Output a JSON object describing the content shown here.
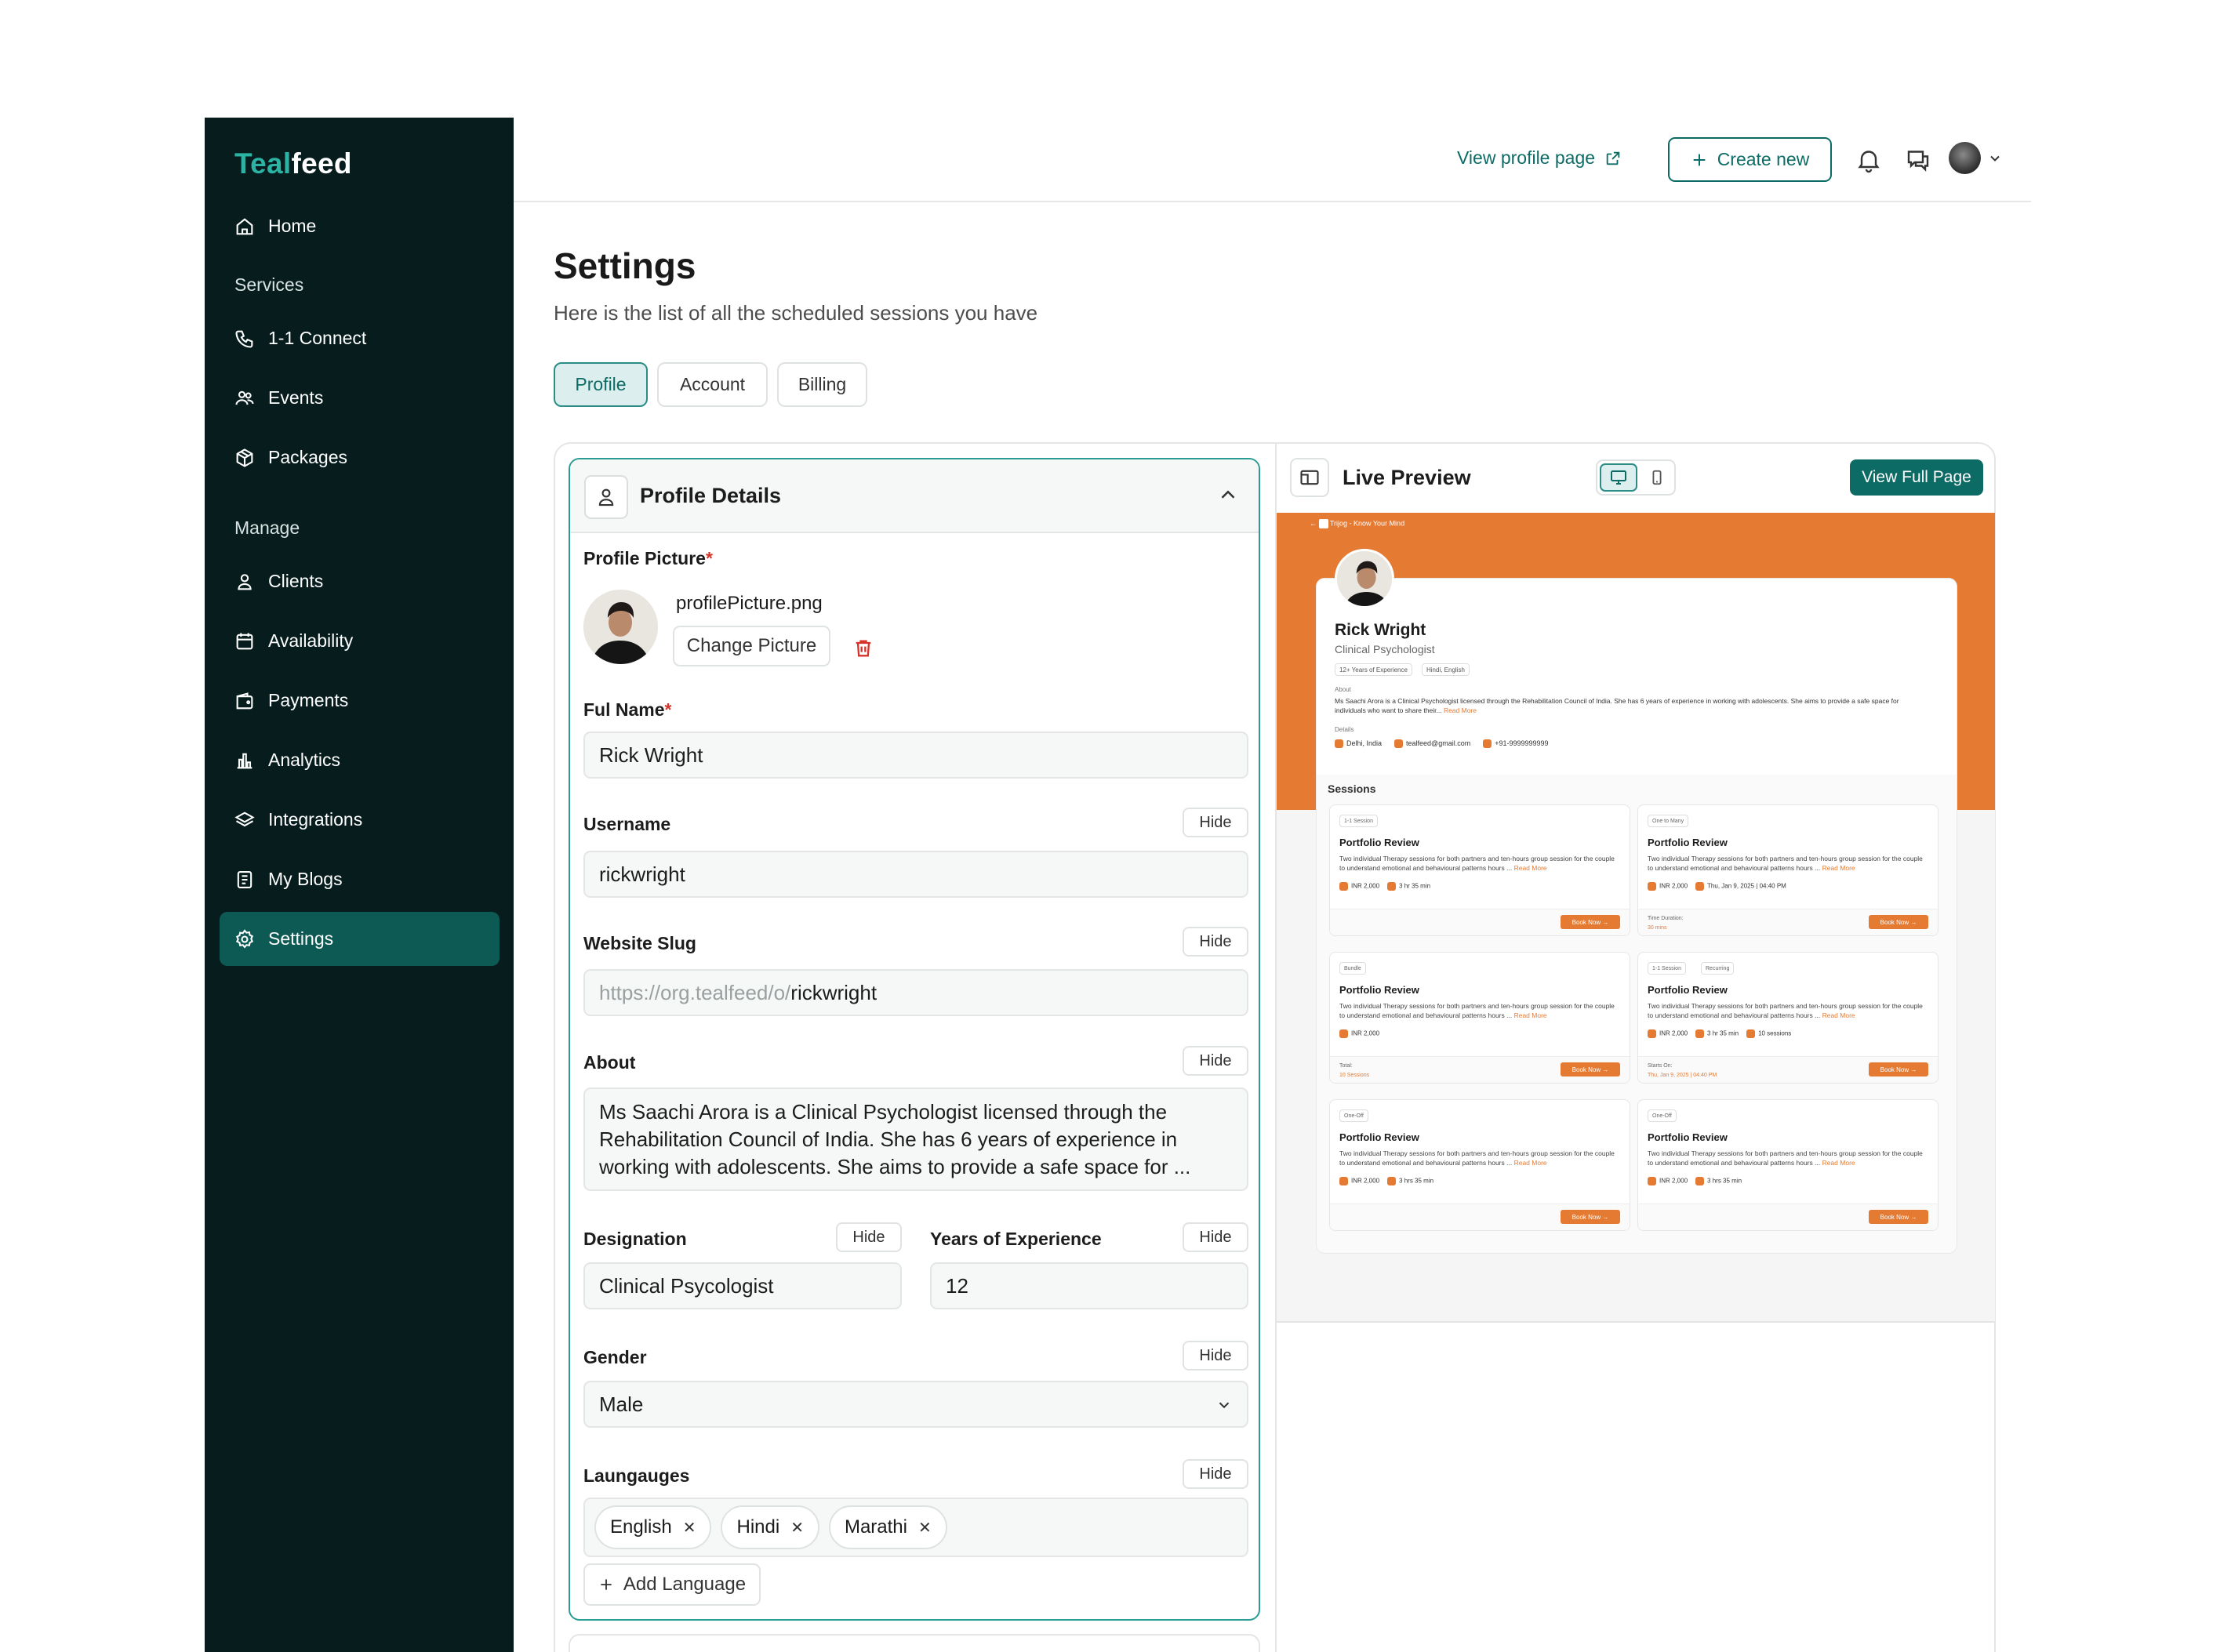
{
  "brand": {
    "part1": "Teal",
    "part2": "feed",
    "accent": "#2bb3a4",
    "sidebar_bg": "#061c1d",
    "primary": "#0d6b65",
    "preview_accent": "#e57a32"
  },
  "sidebar": {
    "home": "Home",
    "services_heading": "Services",
    "services": [
      "1-1 Connect",
      "Events",
      "Packages"
    ],
    "manage_heading": "Manage",
    "manage": [
      "Clients",
      "Availability",
      "Payments",
      "Analytics",
      "Integrations",
      "My Blogs",
      "Settings"
    ],
    "active": "Settings"
  },
  "header": {
    "view_profile": "View profile page",
    "create_new": "Create new",
    "icons": [
      "bell-icon",
      "chat-icon",
      "avatar",
      "chevron-down-icon"
    ]
  },
  "page": {
    "title": "Settings",
    "subtitle": "Here is the list of all the scheduled sessions you have",
    "tabs": [
      "Profile",
      "Account",
      "Billing"
    ],
    "active_tab": "Profile"
  },
  "profile": {
    "section_title": "Profile Details",
    "hide_label": "Hide",
    "picture": {
      "label": "Profile Picture",
      "req": "*",
      "filename": "profilePicture.png",
      "change": "Change Picture"
    },
    "fullname": {
      "label": "Ful Name",
      "req": "*",
      "value": "Rick Wright"
    },
    "username": {
      "label": "Username",
      "value": "rickwright"
    },
    "slug": {
      "label": "Website Slug",
      "prefix": "https://org.tealfeed/o/",
      "value": "rickwright"
    },
    "about": {
      "label": "About",
      "value": "Ms Saachi Arora is a Clinical Psychologist licensed through the Rehabilitation Council of India. She has 6 years of experience in working with adolescents. She aims to provide a safe space for ..."
    },
    "designation": {
      "label": "Designation",
      "value": "Clinical Psycologist"
    },
    "experience": {
      "label": "Years of Experience",
      "value": "12"
    },
    "gender": {
      "label": "Gender",
      "value": "Male"
    },
    "languages": {
      "label": "Laungauges",
      "items": [
        "English",
        "Hindi",
        "Marathi"
      ],
      "add": "Add Language"
    }
  },
  "preview": {
    "title": "Live Preview",
    "view_full": "View Full Page",
    "topbar": "Trijog - Know Your Mind",
    "name": "Rick Wright",
    "role": "Clinical Psychologist",
    "tags": [
      "12+ Years of Experience",
      "Hindi, English"
    ],
    "about_label": "About",
    "about": "Ms Saachi Arora is a Clinical Psychologist licensed through the Rehabilitation Council of India. She has 6 years of experience in working with adolescents. She aims to provide a safe space for individuals who want to share their...",
    "read_more": "Read More",
    "details_label": "Details",
    "details": [
      "Delhi, India",
      "tealfeed@gmail.com",
      "+91-9999999999"
    ],
    "sessions_label": "Sessions",
    "sessions": [
      {
        "tags": [
          "1-1 Session"
        ],
        "title": "Portfolio Review",
        "desc": "Two individual Therapy sessions for both partners and ten-hours group session for the couple to understand emotional and behavioural patterns hours ...",
        "meta": [
          "INR 2,000",
          "3 hr 35 min"
        ],
        "foot_label": "",
        "foot_value": "",
        "book": "Book Now →"
      },
      {
        "tags": [
          "One to Many"
        ],
        "title": "Portfolio Review",
        "desc": "Two individual Therapy sessions for both partners and ten-hours group session for the couple to understand emotional and behavioural patterns hours ...",
        "meta": [
          "INR 2,000",
          "Thu, Jan 9, 2025 | 04:40 PM"
        ],
        "foot_label": "Time Duration:",
        "foot_value": "30 mins",
        "book": "Book Now →"
      },
      {
        "tags": [
          "Bundle"
        ],
        "title": "Portfolio Review",
        "desc": "Two individual Therapy sessions for both partners and ten-hours group session for the couple to understand emotional and behavioural patterns hours ...",
        "meta": [
          "INR 2,000"
        ],
        "foot_label": "Total:",
        "foot_value": "10 Sessions",
        "book": "Book Now →"
      },
      {
        "tags": [
          "1-1 Session",
          "Recurring"
        ],
        "title": "Portfolio Review",
        "desc": "Two individual Therapy sessions for both partners and ten-hours group session for the couple to understand emotional and behavioural patterns hours ...",
        "meta": [
          "INR 2,000",
          "3 hr 35 min",
          "10 sessions"
        ],
        "foot_label": "Starts On:",
        "foot_value": "Thu, Jan 9, 2025 | 04:40 PM",
        "book": "Book Now →"
      },
      {
        "tags": [
          "One-Off"
        ],
        "title": "Portfolio Review",
        "desc": "Two individual Therapy sessions for both partners and ten-hours group session for the couple to understand emotional and behavioural patterns hours ...",
        "meta": [
          "INR 2,000",
          "3 hrs 35 min"
        ],
        "foot_label": "",
        "foot_value": "",
        "book": "Book Now →"
      },
      {
        "tags": [
          "One-Off"
        ],
        "title": "Portfolio Review",
        "desc": "Two individual Therapy sessions for both partners and ten-hours group session for the couple to understand emotional and behavioural patterns hours ...",
        "meta": [
          "INR 2,000",
          "3 hrs 35 min"
        ],
        "foot_label": "",
        "foot_value": "",
        "book": "Book Now →"
      }
    ]
  }
}
